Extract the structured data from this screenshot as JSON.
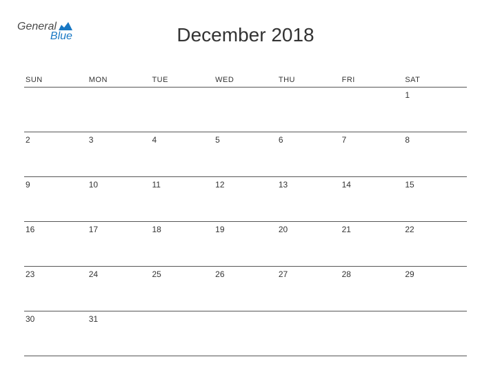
{
  "logo": {
    "text_general": "General",
    "text_blue": "Blue"
  },
  "title": "December 2018",
  "day_headers": [
    "SUN",
    "MON",
    "TUE",
    "WED",
    "THU",
    "FRI",
    "SAT"
  ],
  "weeks": [
    [
      "",
      "",
      "",
      "",
      "",
      "",
      "1"
    ],
    [
      "2",
      "3",
      "4",
      "5",
      "6",
      "7",
      "8"
    ],
    [
      "9",
      "10",
      "11",
      "12",
      "13",
      "14",
      "15"
    ],
    [
      "16",
      "17",
      "18",
      "19",
      "20",
      "21",
      "22"
    ],
    [
      "23",
      "24",
      "25",
      "26",
      "27",
      "28",
      "29"
    ],
    [
      "30",
      "31",
      "",
      "",
      "",
      "",
      ""
    ]
  ]
}
